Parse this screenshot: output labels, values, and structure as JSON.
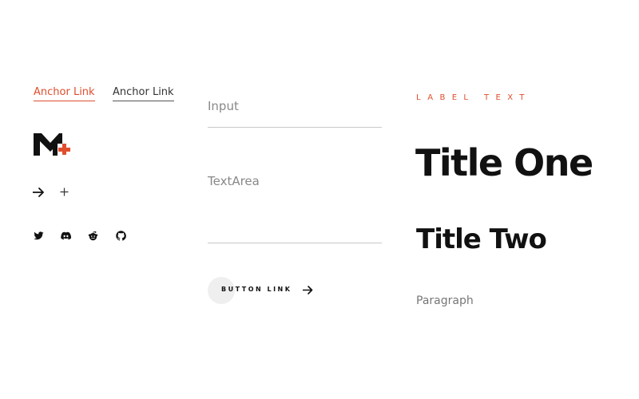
{
  "colors": {
    "accent": "#e04e2e",
    "text": "#111111",
    "muted": "#888888"
  },
  "links": {
    "anchor_primary": "Anchor Link",
    "anchor_secondary": "Anchor Link"
  },
  "icons": {
    "logo": "m-plus-logo",
    "row1": [
      "arrow-right-icon",
      "plus-icon"
    ],
    "social": [
      "twitter-icon",
      "discord-icon",
      "reddit-icon",
      "github-icon"
    ]
  },
  "form": {
    "input_placeholder": "Input",
    "textarea_placeholder": "TextArea",
    "button_label": "BUTTON LINK"
  },
  "typography": {
    "label": "LABEL TEXT",
    "title_one": "Title One",
    "title_two": "Title Two",
    "paragraph": "Paragraph"
  }
}
